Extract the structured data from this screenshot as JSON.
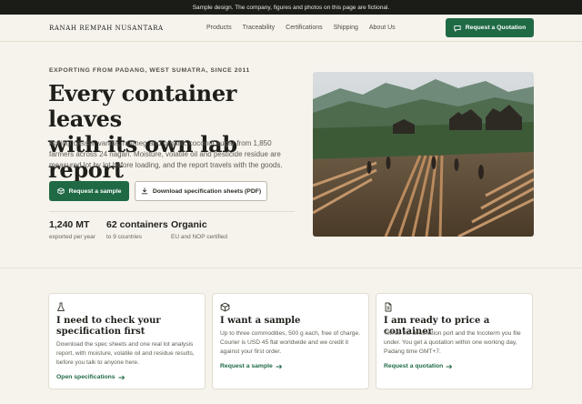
{
  "banner": "Sample design. The company, figures and photos on this page are fictional.",
  "brand": "RANAH REMPAH NUSANTARA",
  "nav": [
    "Products",
    "Traceability",
    "Certifications",
    "Shipping",
    "About Us"
  ],
  "nav_cta": "Request a Quotation",
  "hero": {
    "eyebrow": "EXPORTING FROM PADANG, WEST SUMATRA, SINCE 2011",
    "title_line1": "Every container leaves",
    "title_line2": "with its own lab report",
    "lede": "Korintji cassia, vanilla, nutmeg and organic coconut sugar from 1,850 farmers across 24 nagari. Moisture, volatile oil and pesticide residue are measured lot by lot before loading, and the report travels with the goods.",
    "primary_button": "Request a sample",
    "secondary_button": "Download specification sheets (PDF)"
  },
  "stats": [
    {
      "value": "1,240 MT",
      "label": "exported per year"
    },
    {
      "value": "62 containers",
      "label": "to 9 countries"
    },
    {
      "value": "Organic",
      "label": "EU and NOP certified"
    }
  ],
  "cards": [
    {
      "icon": "flask-icon",
      "title": "I need to check your specification first",
      "body": "Download the spec sheets and one real lot analysis report, with moisture, volatile oil and residue results, before you talk to anyone here.",
      "link": "Open specifications"
    },
    {
      "icon": "box-icon",
      "title": "I want a sample",
      "body": "Up to three commodities, 500 g each, free of charge. Courier is USD 45 flat worldwide and we credit it against your first order.",
      "link": "Request a sample"
    },
    {
      "icon": "document-icon",
      "title": "I am ready to price a container",
      "body": "Tell us the destination port and the Incoterm you file under. You get a quotation within one working day, Padang time GMT+7.",
      "link": "Request a quotation"
    }
  ],
  "colors": {
    "accent": "#1f6a45",
    "background": "#f6f3ec",
    "banner": "#1b1b18"
  }
}
